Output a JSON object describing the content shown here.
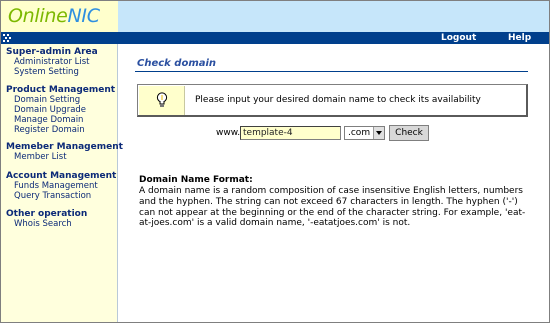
{
  "logo": {
    "part1": "Online",
    "part2": "NIC"
  },
  "nav": {
    "logout": "Logout",
    "help": "Help"
  },
  "sidebar": {
    "groups": [
      {
        "title": "Super-admin Area",
        "items": [
          "Administrator List",
          "System Setting"
        ]
      },
      {
        "title": "Product Management",
        "items": [
          "Domain Setting",
          "Domain Upgrade",
          "Manage Domain",
          "Register Domain"
        ]
      },
      {
        "title": "Memeber Management",
        "items": [
          "Member List"
        ]
      },
      {
        "title": "Account Management",
        "items": [
          "Funds Management",
          "Query Transaction"
        ]
      },
      {
        "title": "Other operation",
        "items": [
          "Whois Search"
        ]
      }
    ]
  },
  "main": {
    "title": "Check domain",
    "info": "Please input your desired domain name to check its availability",
    "www_prefix": "www.",
    "domain_value": "template-4",
    "tld_selected": ".com",
    "check_label": "Check",
    "format_heading": "Domain Name Format:",
    "format_body": "A domain name is a random composition of case insensitive English letters, numbers and the hyphen. The string can not exceed 67 characters in length. The hyphen ('-') can not appear at the beginning or the end of the character string. For example, 'eat-at-joes.com' is a valid domain name, '-eatatjoes.com' is not."
  },
  "colors": {
    "nav_bg": "#003f8c",
    "header_light": "#c6e6fa",
    "sidebar_bg": "#ffffdd",
    "link": "#0c2a78",
    "title": "#2a4fa0"
  }
}
